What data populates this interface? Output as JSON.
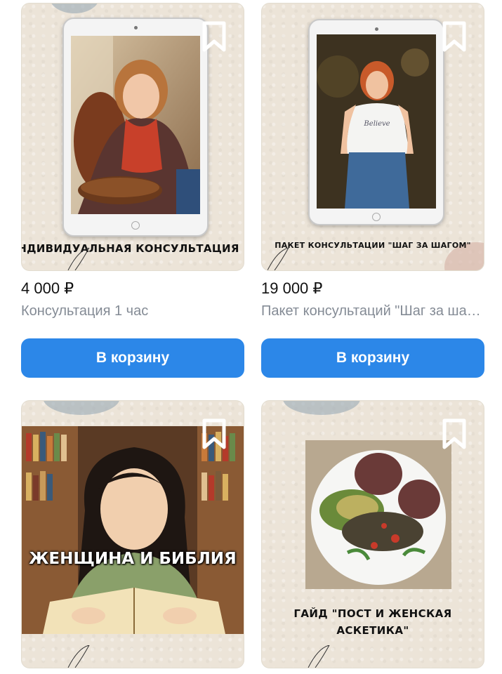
{
  "products": [
    {
      "price": "4 000 ₽",
      "title": "Консультация 1 час",
      "image_caption": "НДИВИДУАЛЬНАЯ КОНСУЛЬТАЦИЯ",
      "button_label": "В корзину"
    },
    {
      "price": "19 000 ₽",
      "title": "Пакет консультаций \"Шаг за шагом\"",
      "image_caption": "ПАКЕТ КОНСУЛЬТАЦИИ  \"ШАГ ЗА ШАГОМ\"",
      "button_label": "В корзину"
    },
    {
      "image_caption": "ЖЕНЩИНА И БИБЛИЯ"
    },
    {
      "image_caption_line1": "ГАЙД \"ПОСТ И ЖЕНСКАЯ",
      "image_caption_line2": "АСКЕТИКА\""
    }
  ],
  "icons": {
    "bookmark": "bookmark-icon"
  },
  "colors": {
    "button": "#2c87e8",
    "price": "#111111",
    "subtitle": "#848b95"
  }
}
